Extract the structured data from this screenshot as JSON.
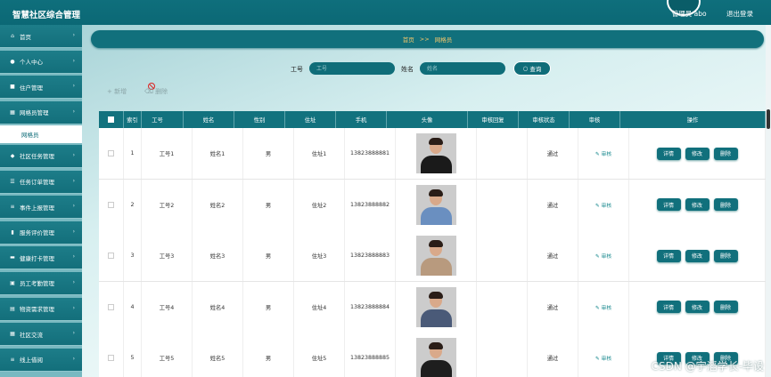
{
  "header": {
    "title": "智慧社区综合管理",
    "user": "管理员 abo",
    "logout": "退出登录"
  },
  "sidebar": {
    "items": [
      {
        "label": "首页",
        "icon": "home-icon",
        "glyph": "⌂"
      },
      {
        "label": "个人中心",
        "icon": "person-icon",
        "glyph": "●"
      },
      {
        "label": "住户管理",
        "icon": "folder-icon",
        "glyph": "■"
      },
      {
        "label": "网格员管理",
        "icon": "grid-icon",
        "glyph": "▦"
      },
      {
        "label": "社区任务管理",
        "icon": "task-icon",
        "glyph": "◆"
      },
      {
        "label": "任务订单管理",
        "icon": "order-icon",
        "glyph": "☰"
      },
      {
        "label": "事件上报管理",
        "icon": "list-icon",
        "glyph": "≡"
      },
      {
        "label": "服务评价管理",
        "icon": "chart-icon",
        "glyph": "▮"
      },
      {
        "label": "健康打卡管理",
        "icon": "card-icon",
        "glyph": "▬"
      },
      {
        "label": "员工考勤管理",
        "icon": "calendar-icon",
        "glyph": "▣"
      },
      {
        "label": "物资需求管理",
        "icon": "box-icon",
        "glyph": "▤"
      },
      {
        "label": "社区交流",
        "icon": "chat-icon",
        "glyph": "▦"
      },
      {
        "label": "线上借阅",
        "icon": "book-icon",
        "glyph": "≡"
      }
    ],
    "sub_item": "网格员"
  },
  "breadcrumb": {
    "home": "首页",
    "sep": ">>",
    "current": "网格员"
  },
  "search": {
    "field1_label": "工号",
    "field1_placeholder": "工号",
    "field2_label": "姓名",
    "field2_placeholder": "姓名",
    "query_button": "查询"
  },
  "actions": {
    "add": "新增",
    "delete": "删除"
  },
  "table": {
    "headers": [
      "索引",
      "工号",
      "姓名",
      "性别",
      "住址",
      "手机",
      "头像",
      "审核回复",
      "审核状态",
      "审核",
      "操作"
    ],
    "rows": [
      {
        "index": "1",
        "id": "工号1",
        "name": "姓名1",
        "gender": "男",
        "address": "住址1",
        "phone": "13823888881",
        "status": "通过"
      },
      {
        "index": "2",
        "id": "工号2",
        "name": "姓名2",
        "gender": "男",
        "address": "住址2",
        "phone": "13823888882",
        "status": "通过"
      },
      {
        "index": "3",
        "id": "工号3",
        "name": "姓名3",
        "gender": "男",
        "address": "住址3",
        "phone": "13823888883",
        "status": "通过"
      },
      {
        "index": "4",
        "id": "工号4",
        "name": "姓名4",
        "gender": "男",
        "address": "住址4",
        "phone": "13823888884",
        "status": "通过"
      },
      {
        "index": "5",
        "id": "工号5",
        "name": "姓名5",
        "gender": "男",
        "address": "住址5",
        "phone": "13823888885",
        "status": "通过"
      }
    ],
    "review_link": "审核",
    "row_buttons": [
      "详情",
      "修改",
      "删除"
    ]
  },
  "watermark": "CSDN @宇滔学长-毕设"
}
